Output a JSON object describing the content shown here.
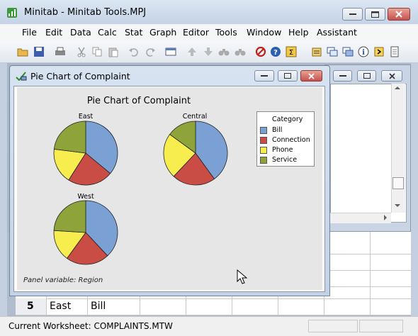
{
  "window": {
    "title": "Minitab - Minitab Tools.MPJ"
  },
  "menu": [
    "File",
    "Edit",
    "Data",
    "Calc",
    "Stat",
    "Graph",
    "Editor",
    "Tools",
    "Window",
    "Help",
    "Assistant"
  ],
  "graph_window": {
    "title": "Pie Chart of Complaint"
  },
  "chart_data": {
    "type": "pie",
    "title": "Pie Chart of Complaint",
    "legend": {
      "title": "Category",
      "placement": "right"
    },
    "categories": [
      "Bill",
      "Connection",
      "Phone",
      "Service"
    ],
    "colors": [
      "#7ba0d4",
      "#c94c45",
      "#f7ed4e",
      "#8fa33b"
    ],
    "panels": [
      {
        "name": "East",
        "values": [
          36,
          23,
          18,
          23
        ]
      },
      {
        "name": "Central",
        "values": [
          40,
          22,
          23,
          15
        ]
      },
      {
        "name": "West",
        "values": [
          38,
          22,
          16,
          24
        ]
      }
    ],
    "panel_variable_note": "Panel variable: Region"
  },
  "worksheet": {
    "row_number": "5",
    "cells": [
      "East",
      "Bill"
    ]
  },
  "status_bar": {
    "text": "Current Worksheet: COMPLAINTS.MTW"
  }
}
